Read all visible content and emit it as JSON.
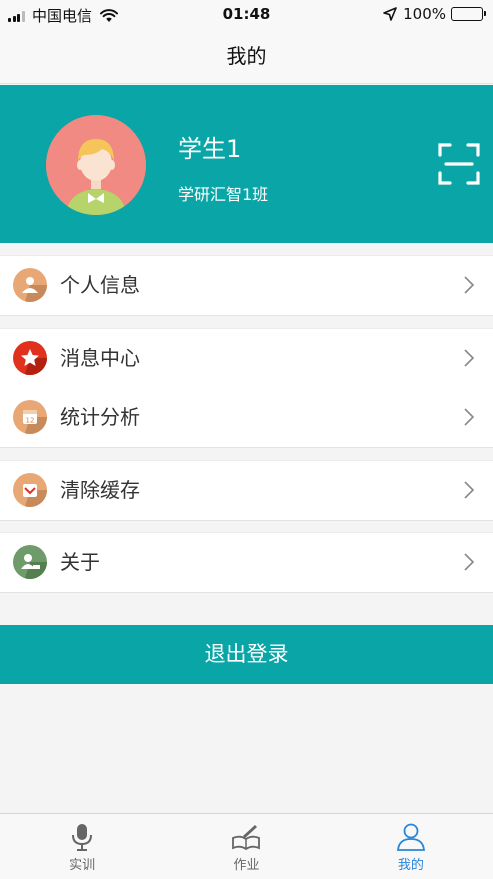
{
  "status_bar": {
    "carrier": "中国电信",
    "time": "01:48",
    "battery": "100%"
  },
  "nav": {
    "title": "我的"
  },
  "profile": {
    "name": "学生1",
    "class_name": "学研汇智1班",
    "background_color": "#0aa5a6"
  },
  "menu": {
    "personal_info": "个人信息",
    "message_center": "消息中心",
    "statistics": "统计分析",
    "clear_cache": "清除缓存",
    "about": "关于"
  },
  "logout_label": "退出登录",
  "tabs": {
    "training": "实训",
    "homework": "作业",
    "mine": "我的"
  },
  "colors": {
    "accent": "#0aa5a6",
    "tab_active": "#2a86d8"
  }
}
